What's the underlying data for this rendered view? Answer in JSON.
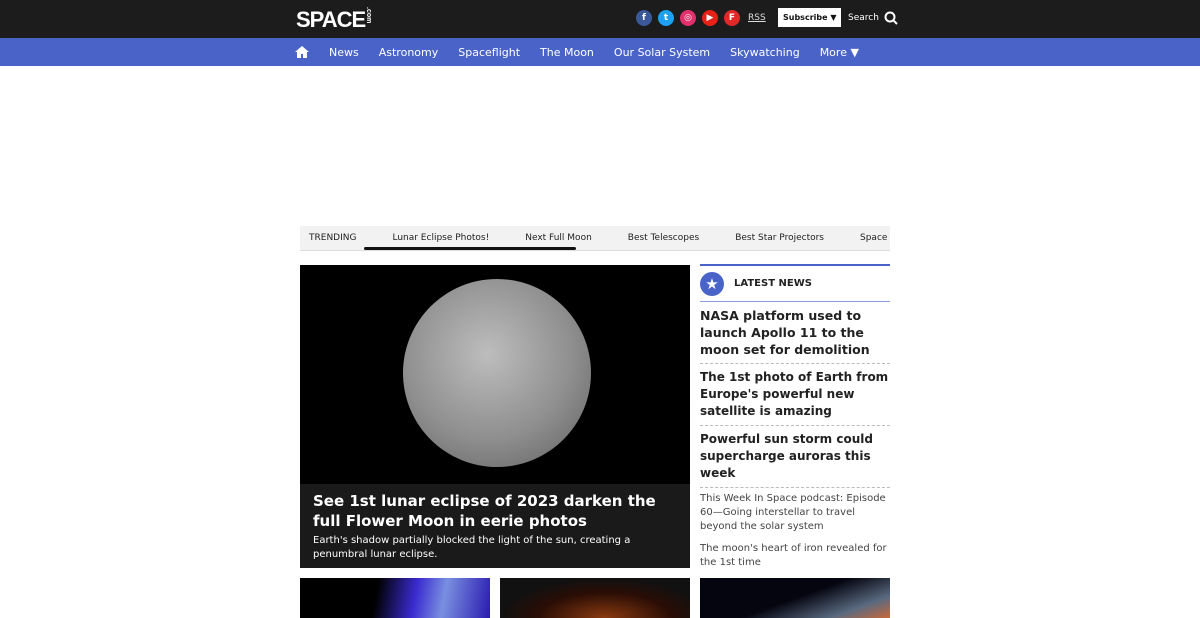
{
  "header": {
    "logo": "SPACE",
    "logo_suffix": ".com",
    "social": [
      {
        "icon": "facebook-icon",
        "glyph": "f",
        "color": "#3b5998"
      },
      {
        "icon": "twitter-icon",
        "glyph": "t",
        "color": "#1da1f2"
      },
      {
        "icon": "instagram-icon",
        "glyph": "◎",
        "color": "#e1306c"
      },
      {
        "icon": "youtube-icon",
        "glyph": "▶",
        "color": "#e62117"
      },
      {
        "icon": "flipboard-icon",
        "glyph": "F",
        "color": "#e12828"
      }
    ],
    "rss": "RSS",
    "subscribe": "Subscribe ▼",
    "search": "Search"
  },
  "nav": {
    "items": [
      "News",
      "Astronomy",
      "Spaceflight",
      "The Moon",
      "Our Solar System",
      "Skywatching",
      "More ▼"
    ]
  },
  "trending": {
    "label": "TRENDING",
    "items": [
      "Lunar Eclipse Photos!",
      "Next Full Moon",
      "Best Telescopes",
      "Best Star Projectors",
      "Space Calendar"
    ]
  },
  "hero": {
    "title": "See 1st lunar eclipse of 2023 darken the full Flower Moon in eerie photos",
    "summary": "Earth's shadow partially blocked the light of the sun, creating a penumbral lunar eclipse."
  },
  "latest": {
    "heading": "LATEST NEWS",
    "items": [
      "NASA platform used to launch Apollo 11 to the moon set for demolition",
      "The 1st photo of Earth from Europe's powerful new satellite is amazing",
      "Powerful sun storm could supercharge auroras this week",
      "This Week In Space podcast: Episode 60—Going interstellar to travel beyond the solar system",
      "The moon's heart of iron revealed for the 1st time"
    ]
  },
  "colors": {
    "accent": "#4a63c9",
    "header_bg": "#1c1c1c"
  }
}
